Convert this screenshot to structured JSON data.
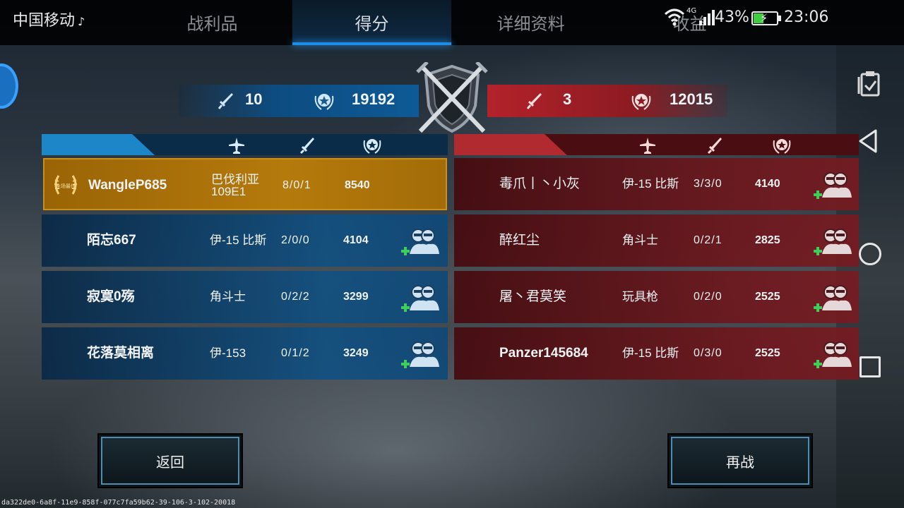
{
  "status_bar": {
    "carrier": "中国移动",
    "network": "4G",
    "battery": "43%",
    "time": "23:06"
  },
  "tabs": [
    {
      "label": "战利品",
      "active": false
    },
    {
      "label": "得分",
      "active": true
    },
    {
      "label": "详细资料",
      "active": false
    },
    {
      "label": "收益",
      "active": false
    }
  ],
  "scores": {
    "blue": {
      "kills": "10",
      "points": "19192"
    },
    "red": {
      "kills": "3",
      "points": "12015"
    }
  },
  "blue_team": [
    {
      "name": "WangleP685",
      "plane": "巴伐利亚109E1",
      "ratio": "8/0/1",
      "score": "8540",
      "mvp": true,
      "badge_text": "全场最佳"
    },
    {
      "name": "陌忘667",
      "plane": "伊-15 比斯",
      "ratio": "2/0/0",
      "score": "4104"
    },
    {
      "name": "寂寞0殇",
      "plane": "角斗士",
      "ratio": "0/2/2",
      "score": "3299"
    },
    {
      "name": "花落莫相离",
      "plane": "伊-153",
      "ratio": "0/1/2",
      "score": "3249"
    }
  ],
  "red_team": [
    {
      "name": "毒爪丨丶小灰",
      "plane": "伊-15 比斯",
      "ratio": "3/3/0",
      "score": "4140"
    },
    {
      "name": "醉红尘",
      "plane": "角斗士",
      "ratio": "0/2/1",
      "score": "2825"
    },
    {
      "name": "屠丶君莫笑",
      "plane": "玩具枪",
      "ratio": "0/2/0",
      "score": "2525"
    },
    {
      "name": "Panzer145684",
      "plane": "伊-15 比斯",
      "ratio": "0/3/0",
      "score": "2525"
    }
  ],
  "buttons": {
    "back": "返回",
    "rematch": "再战"
  },
  "footer_id": "da322de0-6a8f-11e9-858f-077c7fa59b62-39-106-3-102-20018",
  "colors": {
    "blue_accent": "#1d86c8",
    "red_accent": "#b02a30",
    "mvp_gold": "#b57a0c"
  }
}
